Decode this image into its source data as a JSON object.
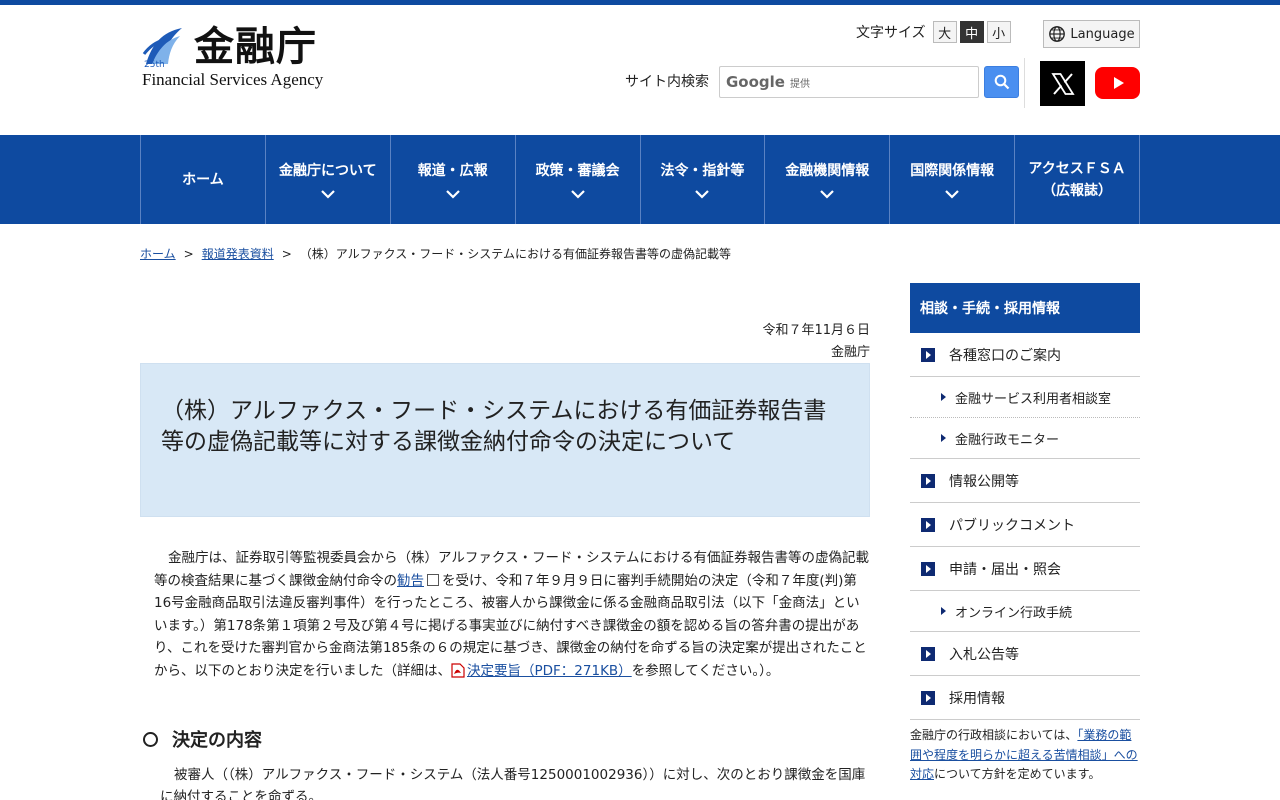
{
  "header": {
    "logo_title": "金融庁",
    "logo_sub": "Financial Services Agency",
    "logo_badge": "25th",
    "fontsize_label": "文字サイズ",
    "fontsize_options": [
      "大",
      "中",
      "小"
    ],
    "language_label": "Language",
    "search_label": "サイト内検索",
    "search_google": "Google",
    "search_provided": "提供"
  },
  "nav": {
    "items": [
      {
        "label": "ホーム",
        "label2": ""
      },
      {
        "label": "金融庁について",
        "label2": ""
      },
      {
        "label": "報道・広報",
        "label2": ""
      },
      {
        "label": "政策・審議会",
        "label2": ""
      },
      {
        "label": "法令・指針等",
        "label2": ""
      },
      {
        "label": "金融機関情報",
        "label2": ""
      },
      {
        "label": "国際関係情報",
        "label2": ""
      },
      {
        "label": "アクセスＦＳＡ",
        "label2": "（広報誌）"
      }
    ]
  },
  "breadcrumb": {
    "home": "ホーム",
    "press": "報道発表資料",
    "sep": ">",
    "current": "（株）アルファクス・フード・システムにおける有価証券報告書等の虚偽記載等"
  },
  "article": {
    "date": "令和７年11月６日",
    "org": "金融庁",
    "title": "（株）アルファクス・フード・システムにおける有価証券報告書等の虚偽記載等に対する課徴金納付命令の決定について",
    "body_1": "金融庁は、証券取引等監視委員会から（株）アルファクス・フード・システムにおける有価証券報告書等の虚偽記載等の検査結果に基づく課徴金納付命令の",
    "body_link1": "勧告",
    "body_2": "を受け、令和７年９月９日に審判手続開始の決定（令和７年度(判)第16号金融商品取引法違反審判事件）を行ったところ、被審人から課徴金に係る金融商品取引法（以下「金商法」といいます。）第178条第１項第２号及び第４号に掲げる事実並びに納付すべき課徴金の額を認める旨の答弁書の提出があり、これを受けた審判官から金商法第185条の６の規定に基づき、課徴金の納付を命ずる旨の決定案が提出されたことから、以下のとおり決定を行いました（詳細は、",
    "body_link2": "決定要旨（PDF：271KB）",
    "body_3": "を参照してください。）。",
    "section_title": "決定の内容",
    "section_text": "被審人（（株）アルファクス・フード・システム（法人番号1250001002936））に対し、次のとおり課徴金を国庫に納付することを命ずる。"
  },
  "sidebar": {
    "heading": "相談・手続・採用情報",
    "items": [
      {
        "label": "各種窓口のご案内",
        "type": "main"
      },
      {
        "label": "金融サービス利用者相談室",
        "type": "sub"
      },
      {
        "label": "金融行政モニター",
        "type": "sub-last"
      },
      {
        "label": "情報公開等",
        "type": "main"
      },
      {
        "label": "パブリックコメント",
        "type": "main"
      },
      {
        "label": "申請・届出・照会",
        "type": "main"
      },
      {
        "label": "オンライン行政手続",
        "type": "sub-last"
      },
      {
        "label": "入札公告等",
        "type": "main"
      },
      {
        "label": "採用情報",
        "type": "main"
      }
    ],
    "note_1": "金融庁の行政相談においては、",
    "note_link": "「業務の範囲や程度を明らかに超える苦情相談」への対応",
    "note_2": "について方針を定めています。"
  }
}
